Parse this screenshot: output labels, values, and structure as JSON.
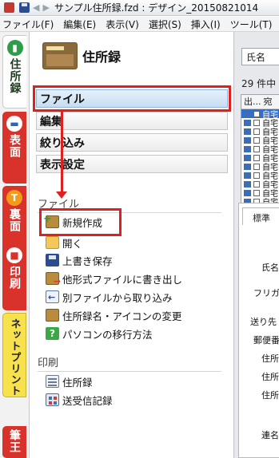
{
  "window": {
    "title": "サンプル住所録.fzd : デザイン_20150821014"
  },
  "menubar": [
    "ファイル(F)",
    "編集(E)",
    "表示(V)",
    "選択(S)",
    "挿入(I)",
    "ツール(T)"
  ],
  "vtabs": {
    "address_book": "住所録",
    "front": "表面",
    "back": "裏面",
    "print": "印刷",
    "net_print": "ネットプリント",
    "extra": "筆王"
  },
  "panel": {
    "title": "住所録",
    "categories": {
      "file": "ファイル",
      "edit": "編集",
      "filter": "絞り込み",
      "display": "表示設定"
    },
    "file_section": {
      "heading": "ファイル",
      "items": {
        "new": "新規作成",
        "open": "開く",
        "save": "上書き保存",
        "export": "他形式ファイルに書き出し",
        "import": "別ファイルから取り込み",
        "rename": "住所録名・アイコンの変更",
        "migrate": "パソコンの移行方法"
      }
    },
    "print_section": {
      "heading": "印刷",
      "items": {
        "address_book": "住所録",
        "send_receive": "送受信記録"
      }
    }
  },
  "right_pane": {
    "name_field": "氏名",
    "record_count": "29 件中",
    "grid_headers": [
      "出...",
      "宛"
    ],
    "grid_rows": [
      "自宅",
      "自宅",
      "自宅",
      "自宅",
      "自宅",
      "自宅",
      "自宅",
      "自宅",
      "自宅",
      "自宅",
      "自宅",
      "自宅"
    ],
    "detail_tab": "標準",
    "labels": {
      "name": "氏名",
      "furigana": "フリガナ",
      "destination": "送り先",
      "postal": "郵便番",
      "address1": "住所",
      "address2": "住所",
      "address3": "住所",
      "joint": "連名"
    }
  },
  "colors": {
    "highlight": "#e02020",
    "tab_red": "#d9322b",
    "tab_green": "#2e9d4a",
    "net_print_yellow": "#f7e24d",
    "selected_blue": "#2f6fd3"
  },
  "icons": [
    "app-icon",
    "save-icon",
    "back-arrow-icon",
    "forward-arrow-icon",
    "book-icon",
    "new-file-icon",
    "open-folder-icon",
    "floppy-save-icon",
    "export-icon",
    "import-icon",
    "book-edit-icon",
    "help-icon",
    "print-list-icon",
    "send-log-icon"
  ]
}
